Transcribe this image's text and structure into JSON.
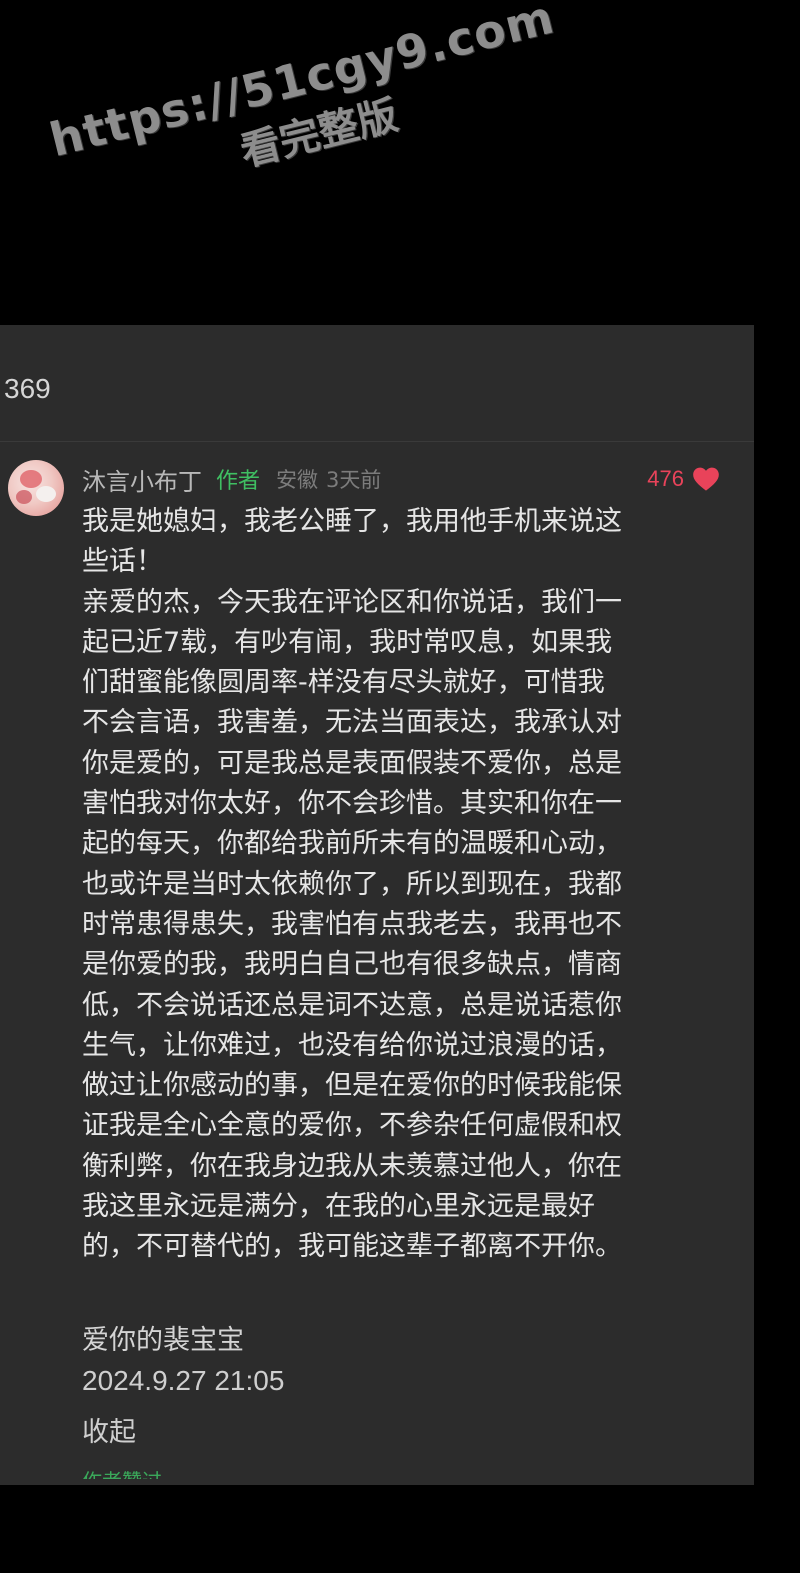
{
  "watermark": {
    "url": "https://51cgy9.com",
    "caption": "看完整版"
  },
  "header": {
    "count": "369"
  },
  "comment": {
    "username": "沐言小布丁",
    "author_badge": "作者",
    "location": "安徽",
    "time_ago": "3天前",
    "like_count": "476",
    "body_lines": [
      "我是她媳妇，我老公睡了，我用他手机来说这",
      "些话！",
      "亲爱的杰，今天我在评论区和你说话，我们一",
      "起已近7载，有吵有闹，我时常叹息，如果我",
      "们甜蜜能像圆周率-样没有尽头就好，可惜我",
      "不会言语，我害羞，无法当面表达，我承认对",
      "你是爱的，可是我总是表面假装不爱你，总是",
      "害怕我对你太好，你不会珍惜。其实和你在一",
      "起的每天，你都给我前所未有的温暖和心动，",
      "也或许是当时太依赖你了，所以到现在，我都",
      "时常患得患失，我害怕有点我老去，我再也不",
      "是你爱的我，我明白自己也有很多缺点，情商",
      "低，不会说话还总是词不达意，总是说话惹你",
      "生气，让你难过，也没有给你说过浪漫的话，",
      "做过让你感动的事，但是在爱你的时候我能保",
      "证我是全心全意的爱你，不参杂任何虚假和权",
      "衡利弊，你在我身边我从未羡慕过他人，你在",
      "我这里永远是满分，在我的心里永远是最好",
      "的，不可替代的，我可能这辈子都离不开你。"
    ],
    "signature": "爱你的裴宝宝",
    "date": "2024.9.27 21:05",
    "collapse_label": "收起",
    "cut_text": "作者赞过"
  },
  "colors": {
    "background": "#000000",
    "panel": "#2c2c2c",
    "author_badge": "#3fbf62",
    "like": "#e9435a"
  },
  "icons": {
    "like": "heart-icon",
    "avatar": "avatar"
  }
}
